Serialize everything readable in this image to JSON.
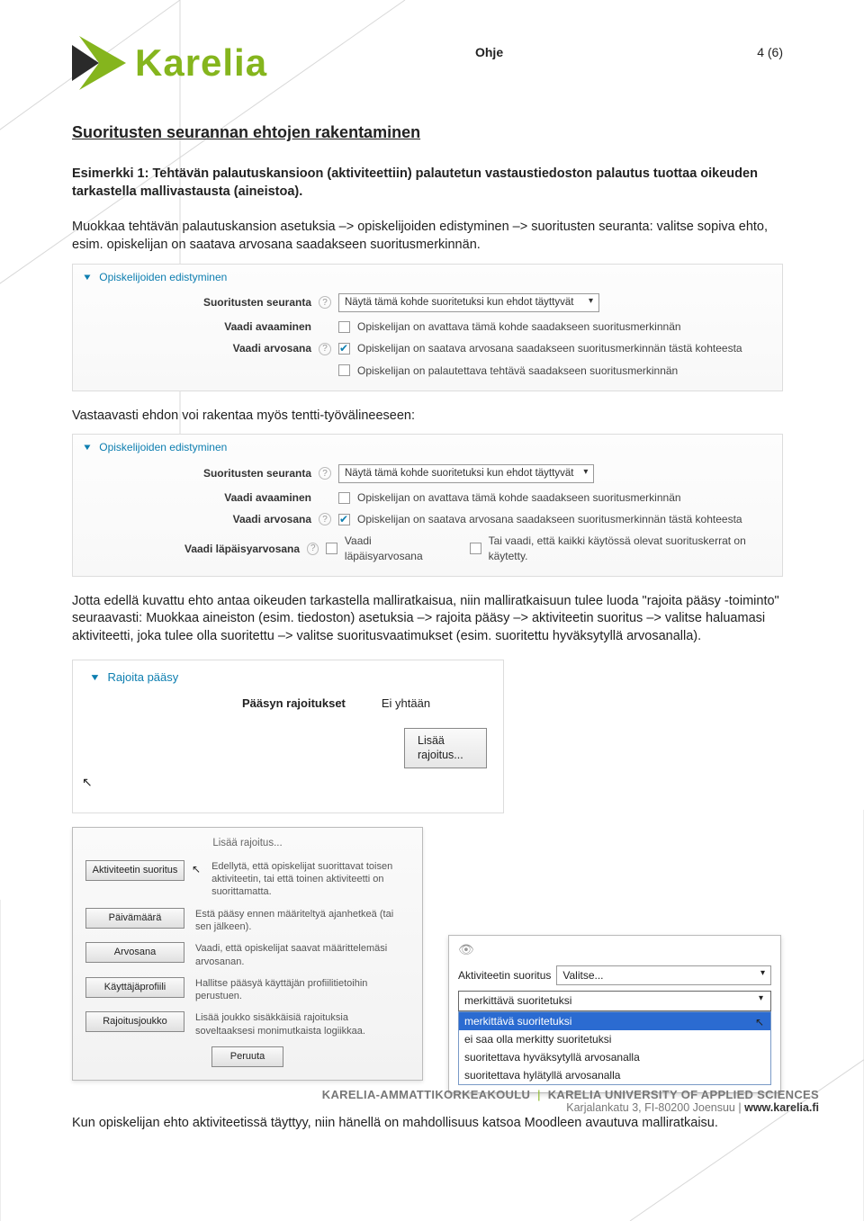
{
  "header": {
    "doc_type": "Ohje",
    "page_indicator": "4 (6)",
    "brand": "Karelia"
  },
  "title": "Suoritusten seurannan ehtojen rakentaminen",
  "example_heading": "Esimerkki 1: Tehtävän palautuskansioon (aktiviteettiin) palautetun vastaustiedoston palautus tuottaa oikeuden tarkastella mallivastausta (aineistoa).",
  "para1": "Muokkaa tehtävän palautuskansion asetuksia –> opiskelijoiden edistyminen –> suoritusten seuranta: valitse sopiva ehto, esim. opiskelijan on saatava arvosana saadakseen suoritusmerkinnän.",
  "panel1": {
    "section": "Opiskelijoiden edistyminen",
    "r1_label": "Suoritusten seuranta",
    "r1_select": "Näytä tämä kohde suoritetuksi kun ehdot täyttyvät",
    "r2_label": "Vaadi avaaminen",
    "r2_text": "Opiskelijan on avattava tämä kohde saadakseen suoritusmerkinnän",
    "r3_label": "Vaadi arvosana",
    "r3_text": "Opiskelijan on saatava arvosana saadakseen suoritusmerkinnän tästä kohteesta",
    "r4_text": "Opiskelijan on palautettava tehtävä saadakseen suoritusmerkinnän"
  },
  "para2": "Vastaavasti ehdon voi rakentaa myös tentti-työvälineeseen:",
  "panel2": {
    "section": "Opiskelijoiden edistyminen",
    "r1_label": "Suoritusten seuranta",
    "r1_select": "Näytä tämä kohde suoritetuksi kun ehdot täyttyvät",
    "r2_label": "Vaadi avaaminen",
    "r2_text": "Opiskelijan on avattava tämä kohde saadakseen suoritusmerkinnän",
    "r3_label": "Vaadi arvosana",
    "r3_text": "Opiskelijan on saatava arvosana saadakseen suoritusmerkinnän tästä kohteesta",
    "r4_label": "Vaadi läpäisyarvosana",
    "r4_text1": "Vaadi läpäisyarvosana",
    "r4_text2": "Tai vaadi, että kaikki käytössä olevat suorituskerrat on käytetty."
  },
  "para3": "Jotta edellä kuvattu ehto antaa oikeuden tarkastella malliratkaisua, niin malliratkaisuun tulee luoda \"rajoita pääsy -toiminto\" seuraavasti: Muokkaa aineiston (esim. tiedoston) asetuksia –> rajoita pääsy –> aktiviteetin suoritus –> valitse haluamasi aktiviteetti, joka tulee olla suoritettu –> valitse suoritusvaatimukset (esim. suoritettu hyväksytyllä arvosanalla).",
  "restrict": {
    "section": "Rajoita pääsy",
    "label": "Pääsyn rajoitukset",
    "value": "Ei yhtään",
    "button": "Lisää rajoitus..."
  },
  "dialog": {
    "title": "Lisää rajoitus...",
    "rows": [
      {
        "btn": "Aktiviteetin suoritus",
        "desc": "Edellytä, että opiskelijat suorittavat toisen aktiviteetin, tai että toinen aktiviteetti on suorittamatta."
      },
      {
        "btn": "Päivämäärä",
        "desc": "Estä pääsy ennen määriteltyä ajanhetkeä (tai sen jälkeen)."
      },
      {
        "btn": "Arvosana",
        "desc": "Vaadi, että opiskelijat saavat määrittelemäsi arvosanan."
      },
      {
        "btn": "Käyttäjäprofiili",
        "desc": "Hallitse pääsyä käyttäjän profiilitietoihin perustuen."
      },
      {
        "btn": "Rajoitusjoukko",
        "desc": "Lisää joukko sisäkkäisiä rajoituksia soveltaaksesi monimutkaista logiikkaa."
      }
    ],
    "cancel": "Peruuta"
  },
  "popup": {
    "label": "Aktiviteetin suoritus",
    "select_placeholder": "Valitse...",
    "current": "merkittävä suoritetuksi",
    "options": [
      "merkittävä suoritetuksi",
      "ei saa olla merkitty suoritetuksi",
      "suoritettava hyväksytyllä arvosanalla",
      "suoritettava hylätyllä arvosanalla"
    ]
  },
  "para4": "Kun opiskelijan ehto aktiviteetissä täyttyy, niin hänellä on mahdollisuus katsoa Moodleen avautuva malliratkaisu.",
  "footer": {
    "line1a": "KARELIA-AMMATTIKORKEAKOULU",
    "line1b": "KARELIA UNIVERSITY OF APPLIED SCIENCES",
    "line2a": "Karjalankatu 3, FI-80200 Joensuu",
    "line2b": "www.karelia.fi"
  }
}
